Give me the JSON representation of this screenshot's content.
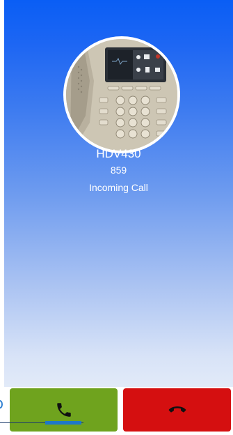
{
  "caller": {
    "name": "HDV430",
    "number": "859",
    "status": "Incoming Call",
    "avatar_icon": "desk-phone-photo"
  },
  "actions": {
    "answer_icon": "phone-handset-icon",
    "decline_icon": "hang-up-icon",
    "answer_color": "#6fa31e",
    "decline_color": "#d50f10"
  },
  "theme": {
    "background_top": "#0a5ef5",
    "background_bottom": "#f1f5fb"
  }
}
